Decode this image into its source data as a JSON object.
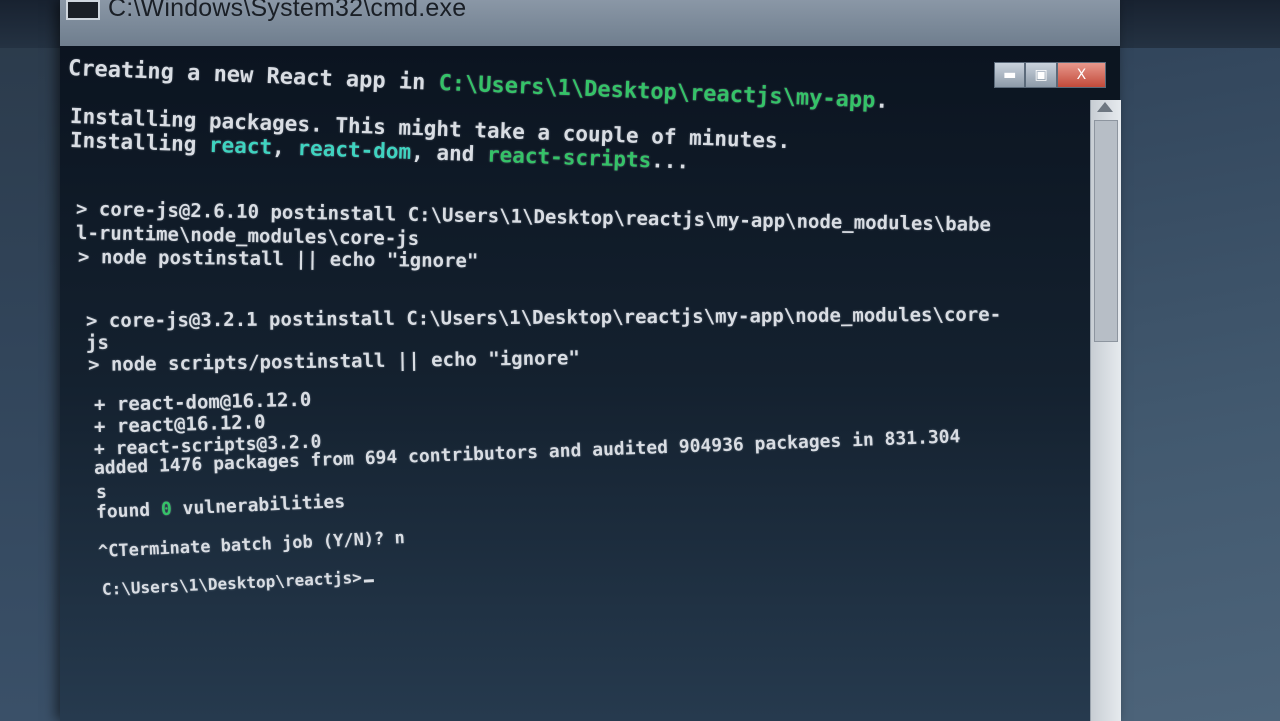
{
  "window": {
    "title": "C:\\Windows\\System32\\cmd.exe",
    "controls": {
      "minimize": "▬",
      "maximize": "▣",
      "close": "X"
    }
  },
  "console": {
    "lines": [
      {
        "segments": [
          {
            "text": "Creating a new React app in ",
            "color": "default"
          },
          {
            "text": "C:\\Users\\1\\Desktop\\reactjs\\my-app",
            "color": "green"
          },
          {
            "text": ".",
            "color": "default"
          }
        ]
      },
      {
        "segments": [
          {
            "text": "Installing packages. This might take a couple of minutes.",
            "color": "default"
          }
        ]
      },
      {
        "segments": [
          {
            "text": "Installing ",
            "color": "default"
          },
          {
            "text": "react",
            "color": "cyan"
          },
          {
            "text": ", ",
            "color": "default"
          },
          {
            "text": "react-dom",
            "color": "cyan"
          },
          {
            "text": ", and ",
            "color": "default"
          },
          {
            "text": "react-scripts",
            "color": "green"
          },
          {
            "text": "...",
            "color": "default"
          }
        ]
      },
      {
        "segments": [
          {
            "text": "> core-js@2.6.10 postinstall C:\\Users\\1\\Desktop\\reactjs\\my-app\\node_modules\\babe",
            "color": "default"
          }
        ]
      },
      {
        "segments": [
          {
            "text": "l-runtime\\node_modules\\core-js",
            "color": "default"
          }
        ]
      },
      {
        "segments": [
          {
            "text": "> node postinstall || echo \"ignore\"",
            "color": "default"
          }
        ]
      },
      {
        "segments": [
          {
            "text": "> core-js@3.2.1 postinstall C:\\Users\\1\\Desktop\\reactjs\\my-app\\node_modules\\core-",
            "color": "default"
          }
        ]
      },
      {
        "segments": [
          {
            "text": "js",
            "color": "default"
          }
        ]
      },
      {
        "segments": [
          {
            "text": "> node scripts/postinstall || echo \"ignore\"",
            "color": "default"
          }
        ]
      },
      {
        "segments": [
          {
            "text": "+ react-dom@16.12.0",
            "color": "default"
          }
        ]
      },
      {
        "segments": [
          {
            "text": "+ react@16.12.0",
            "color": "default"
          }
        ]
      },
      {
        "segments": [
          {
            "text": "+ react-scripts@3.2.0",
            "color": "default"
          }
        ]
      },
      {
        "segments": [
          {
            "text": "added 1476 packages from 694 contributors and audited 904936 packages in 831.304",
            "color": "default"
          }
        ]
      },
      {
        "segments": [
          {
            "text": "s",
            "color": "default"
          }
        ]
      },
      {
        "segments": [
          {
            "text": "found ",
            "color": "default"
          },
          {
            "text": "0",
            "color": "green"
          },
          {
            "text": " vulnerabilities",
            "color": "default"
          }
        ]
      },
      {
        "segments": [
          {
            "text": "^CTerminate batch job (Y/N)? n",
            "color": "default"
          }
        ]
      },
      {
        "segments": [
          {
            "text": "C:\\Users\\1\\Desktop\\reactjs>",
            "color": "default"
          }
        ]
      }
    ]
  },
  "colors": {
    "default": "#d9dde3",
    "cyan": "#3fd3c0",
    "green": "#35c268",
    "console_bg": "#0c1520"
  },
  "icons": {
    "window_icon": "cmd-icon",
    "taskbar": [
      "red-app-icon",
      "green-app-icon",
      "window-thumbnail-icon",
      "notepad-icon"
    ]
  }
}
